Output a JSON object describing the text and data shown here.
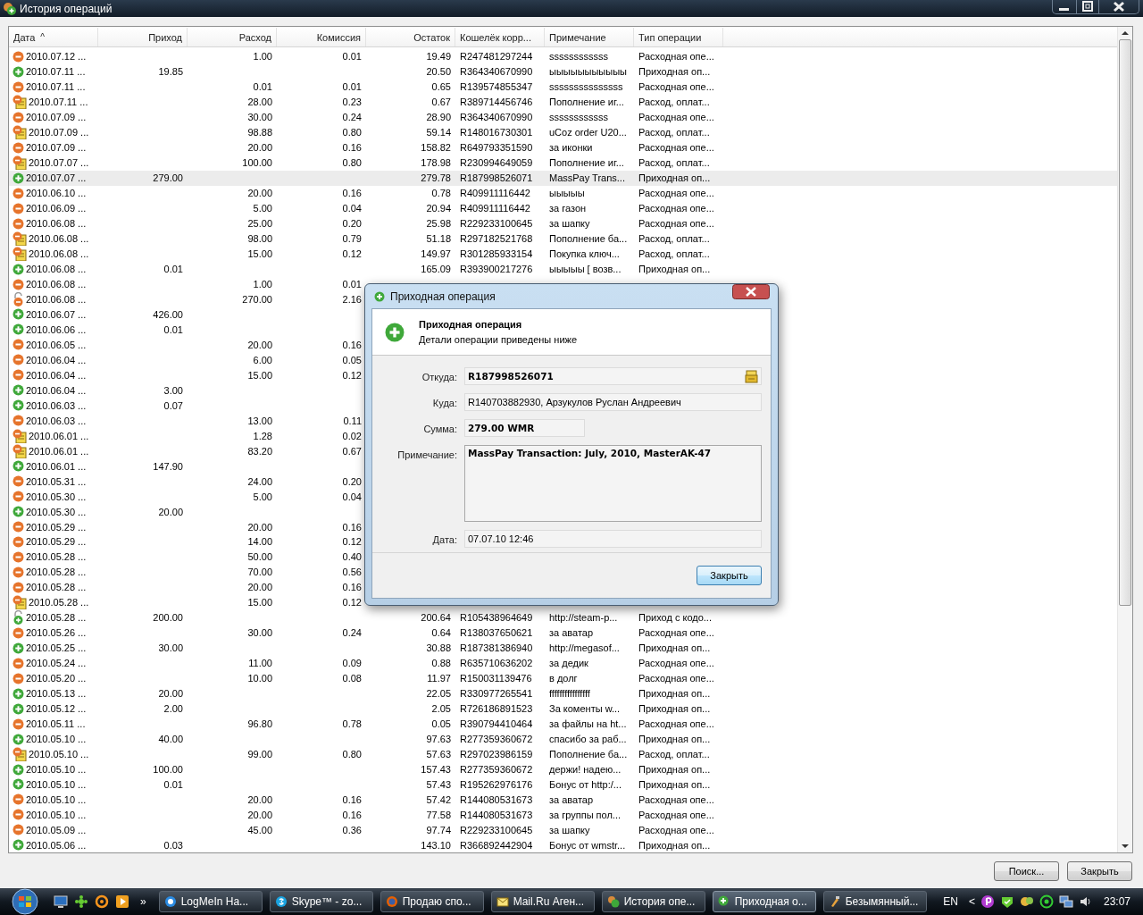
{
  "window": {
    "title": "История операций"
  },
  "table": {
    "columns": [
      {
        "label": "Дата",
        "sort_mark": "^"
      },
      {
        "label": "Приход"
      },
      {
        "label": "Расход"
      },
      {
        "label": "Комиссия"
      },
      {
        "label": "Остаток"
      },
      {
        "label": "Кошелёк корр..."
      },
      {
        "label": "Примечание"
      },
      {
        "label": "Тип операции"
      }
    ],
    "rows": [
      {
        "kind": "expense",
        "selected": false,
        "date": "2010.07.12 ...",
        "expense": "1.00",
        "fee": "0.01",
        "balance": "19.49",
        "wallet": "R247481297244",
        "note": "ssssssssssss",
        "type": "Расходная опе..."
      },
      {
        "kind": "income",
        "selected": false,
        "date": "2010.07.11 ...",
        "income": "19.85",
        "balance": "20.50",
        "wallet": "R364340670990",
        "note": "ыыыыыыыыыыы",
        "type": "Приходная оп..."
      },
      {
        "kind": "expense",
        "selected": false,
        "date": "2010.07.11 ...",
        "expense": "0.01",
        "fee": "0.01",
        "balance": "0.65",
        "wallet": "R139574855347",
        "note": "sssssssssssssss",
        "type": "Расходная опе..."
      },
      {
        "kind": "invoice",
        "selected": false,
        "date": "2010.07.11 ...",
        "expense": "28.00",
        "fee": "0.23",
        "balance": "0.67",
        "wallet": "R389714456746",
        "note": "Пополнение иг...",
        "type": "Расход, оплат..."
      },
      {
        "kind": "expense",
        "selected": false,
        "date": "2010.07.09 ...",
        "expense": "30.00",
        "fee": "0.24",
        "balance": "28.90",
        "wallet": "R364340670990",
        "note": "ssssssssssss",
        "type": "Расходная опе..."
      },
      {
        "kind": "invoice",
        "selected": false,
        "date": "2010.07.09 ...",
        "expense": "98.88",
        "fee": "0.80",
        "balance": "59.14",
        "wallet": "R148016730301",
        "note": "uCoz order U20...",
        "type": "Расход, оплат..."
      },
      {
        "kind": "expense",
        "selected": false,
        "date": "2010.07.09 ...",
        "expense": "20.00",
        "fee": "0.16",
        "balance": "158.82",
        "wallet": "R649793351590",
        "note": "за иконки",
        "type": "Расходная опе..."
      },
      {
        "kind": "invoice",
        "selected": false,
        "date": "2010.07.07 ...",
        "expense": "100.00",
        "fee": "0.80",
        "balance": "178.98",
        "wallet": "R230994649059",
        "note": "Пополнение иг...",
        "type": "Расход, оплат..."
      },
      {
        "kind": "income",
        "selected": true,
        "date": "2010.07.07 ...",
        "income": "279.00",
        "balance": "279.78",
        "wallet": "R187998526071",
        "note": "MassPay Trans...",
        "type": "Приходная оп..."
      },
      {
        "kind": "expense",
        "selected": false,
        "date": "2010.06.10 ...",
        "expense": "20.00",
        "fee": "0.16",
        "balance": "0.78",
        "wallet": "R409911116442",
        "note": "ыыыыы",
        "type": "Расходная опе..."
      },
      {
        "kind": "expense",
        "selected": false,
        "date": "2010.06.09 ...",
        "expense": "5.00",
        "fee": "0.04",
        "balance": "20.94",
        "wallet": "R409911116442",
        "note": "за газон",
        "type": "Расходная опе..."
      },
      {
        "kind": "expense",
        "selected": false,
        "date": "2010.06.08 ...",
        "expense": "25.00",
        "fee": "0.20",
        "balance": "25.98",
        "wallet": "R229233100645",
        "note": "за шапку",
        "type": "Расходная опе..."
      },
      {
        "kind": "invoice",
        "selected": false,
        "date": "2010.06.08 ...",
        "expense": "98.00",
        "fee": "0.79",
        "balance": "51.18",
        "wallet": "R297182521768",
        "note": "Пополнение ба...",
        "type": "Расход, оплат..."
      },
      {
        "kind": "invoice",
        "selected": false,
        "date": "2010.06.08 ...",
        "expense": "15.00",
        "fee": "0.12",
        "balance": "149.97",
        "wallet": "R301285933154",
        "note": "Покупка ключ...",
        "type": "Расход, оплат..."
      },
      {
        "kind": "income",
        "selected": false,
        "date": "2010.06.08 ...",
        "income": "0.01",
        "balance": "165.09",
        "wallet": "R393900217276",
        "note": "ыыыыы [ возв...",
        "type": "Приходная оп..."
      },
      {
        "kind": "expense",
        "selected": false,
        "date": "2010.06.08 ...",
        "expense": "1.00",
        "fee": "0.01"
      },
      {
        "kind": "coded_out",
        "selected": false,
        "date": "2010.06.08 ...",
        "expense": "270.00",
        "fee": "2.16"
      },
      {
        "kind": "income",
        "selected": false,
        "date": "2010.06.07 ...",
        "income": "426.00"
      },
      {
        "kind": "income",
        "selected": false,
        "date": "2010.06.06 ...",
        "income": "0.01"
      },
      {
        "kind": "expense",
        "selected": false,
        "date": "2010.06.05 ...",
        "expense": "20.00",
        "fee": "0.16"
      },
      {
        "kind": "expense",
        "selected": false,
        "date": "2010.06.04 ...",
        "expense": "6.00",
        "fee": "0.05"
      },
      {
        "kind": "expense",
        "selected": false,
        "date": "2010.06.04 ...",
        "expense": "15.00",
        "fee": "0.12"
      },
      {
        "kind": "income",
        "selected": false,
        "date": "2010.06.04 ...",
        "income": "3.00"
      },
      {
        "kind": "income",
        "selected": false,
        "date": "2010.06.03 ...",
        "income": "0.07"
      },
      {
        "kind": "expense",
        "selected": false,
        "date": "2010.06.03 ...",
        "expense": "13.00",
        "fee": "0.11"
      },
      {
        "kind": "invoice",
        "selected": false,
        "date": "2010.06.01 ...",
        "expense": "1.28",
        "fee": "0.02"
      },
      {
        "kind": "invoice",
        "selected": false,
        "date": "2010.06.01 ...",
        "expense": "83.20",
        "fee": "0.67"
      },
      {
        "kind": "income",
        "selected": false,
        "date": "2010.06.01 ...",
        "income": "147.90"
      },
      {
        "kind": "expense",
        "selected": false,
        "date": "2010.05.31 ...",
        "expense": "24.00",
        "fee": "0.20"
      },
      {
        "kind": "expense",
        "selected": false,
        "date": "2010.05.30 ...",
        "expense": "5.00",
        "fee": "0.04"
      },
      {
        "kind": "income",
        "selected": false,
        "date": "2010.05.30 ...",
        "income": "20.00"
      },
      {
        "kind": "expense",
        "selected": false,
        "date": "2010.05.29 ...",
        "expense": "20.00",
        "fee": "0.16"
      },
      {
        "kind": "expense",
        "selected": false,
        "date": "2010.05.29 ...",
        "expense": "14.00",
        "fee": "0.12"
      },
      {
        "kind": "expense",
        "selected": false,
        "date": "2010.05.28 ...",
        "expense": "50.00",
        "fee": "0.40"
      },
      {
        "kind": "expense",
        "selected": false,
        "date": "2010.05.28 ...",
        "expense": "70.00",
        "fee": "0.56"
      },
      {
        "kind": "expense",
        "selected": false,
        "date": "2010.05.28 ...",
        "expense": "20.00",
        "fee": "0.16"
      },
      {
        "kind": "invoice",
        "selected": false,
        "date": "2010.05.28 ...",
        "expense": "15.00",
        "fee": "0.12"
      },
      {
        "kind": "coded_in",
        "selected": false,
        "date": "2010.05.28 ...",
        "income": "200.00",
        "balance": "200.64",
        "wallet": "R105438964649",
        "note": "http://steam-p...",
        "type": "Приход с кодо..."
      },
      {
        "kind": "expense",
        "selected": false,
        "date": "2010.05.26 ...",
        "expense": "30.00",
        "fee": "0.24",
        "balance": "0.64",
        "wallet": "R138037650621",
        "note": "за аватар",
        "type": "Расходная опе..."
      },
      {
        "kind": "income",
        "selected": false,
        "date": "2010.05.25 ...",
        "income": "30.00",
        "balance": "30.88",
        "wallet": "R187381386940",
        "note": "http://megasof...",
        "type": "Приходная оп..."
      },
      {
        "kind": "expense",
        "selected": false,
        "date": "2010.05.24 ...",
        "expense": "11.00",
        "fee": "0.09",
        "balance": "0.88",
        "wallet": "R635710636202",
        "note": "за дедик",
        "type": "Расходная опе..."
      },
      {
        "kind": "expense",
        "selected": false,
        "date": "2010.05.20 ...",
        "expense": "10.00",
        "fee": "0.08",
        "balance": "11.97",
        "wallet": "R150031139476",
        "note": "в долг",
        "type": "Расходная опе..."
      },
      {
        "kind": "income",
        "selected": false,
        "date": "2010.05.13 ...",
        "income": "20.00",
        "balance": "22.05",
        "wallet": "R330977265541",
        "note": "ffffffffffffffff",
        "type": "Приходная оп..."
      },
      {
        "kind": "income",
        "selected": false,
        "date": "2010.05.12 ...",
        "income": "2.00",
        "balance": "2.05",
        "wallet": "R726186891523",
        "note": "За коменты w...",
        "type": "Приходная оп..."
      },
      {
        "kind": "expense",
        "selected": false,
        "date": "2010.05.11 ...",
        "expense": "96.80",
        "fee": "0.78",
        "balance": "0.05",
        "wallet": "R390794410464",
        "note": "за файлы на ht...",
        "type": "Расходная опе..."
      },
      {
        "kind": "income",
        "selected": false,
        "date": "2010.05.10 ...",
        "income": "40.00",
        "balance": "97.63",
        "wallet": "R277359360672",
        "note": "спасибо за раб...",
        "type": "Приходная оп..."
      },
      {
        "kind": "invoice",
        "selected": false,
        "date": "2010.05.10 ...",
        "expense": "99.00",
        "fee": "0.80",
        "balance": "57.63",
        "wallet": "R297023986159",
        "note": "Пополнение ба...",
        "type": "Расход, оплат..."
      },
      {
        "kind": "income",
        "selected": false,
        "date": "2010.05.10 ...",
        "income": "100.00",
        "balance": "157.43",
        "wallet": "R277359360672",
        "note": "держи! надею...",
        "type": "Приходная оп..."
      },
      {
        "kind": "income",
        "selected": false,
        "date": "2010.05.10 ...",
        "income": "0.01",
        "balance": "57.43",
        "wallet": "R195262976176",
        "note": "Бонус от http:/...",
        "type": "Приходная оп..."
      },
      {
        "kind": "expense",
        "selected": false,
        "date": "2010.05.10 ...",
        "expense": "20.00",
        "fee": "0.16",
        "balance": "57.42",
        "wallet": "R144080531673",
        "note": "за аватар",
        "type": "Расходная опе..."
      },
      {
        "kind": "expense",
        "selected": false,
        "date": "2010.05.10 ...",
        "expense": "20.00",
        "fee": "0.16",
        "balance": "77.58",
        "wallet": "R144080531673",
        "note": "за группы пол...",
        "type": "Расходная опе..."
      },
      {
        "kind": "expense",
        "selected": false,
        "date": "2010.05.09 ...",
        "expense": "45.00",
        "fee": "0.36",
        "balance": "97.74",
        "wallet": "R229233100645",
        "note": "за шапку",
        "type": "Расходная опе..."
      },
      {
        "kind": "income",
        "selected": false,
        "date": "2010.05.06 ...",
        "income": "0.03",
        "balance": "143.10",
        "wallet": "R366892442904",
        "note": "Бонус от wmstr...",
        "type": "Приходная оп..."
      }
    ]
  },
  "buttons": [
    "Поиск...",
    "Закрыть"
  ],
  "dialog": {
    "title": "Приходная операция",
    "heading": "Приходная операция",
    "subtitle": "Детали операции приведены ниже",
    "fields": [
      {
        "kind": "wallet",
        "label": "Откуда:",
        "value": "R187998526071",
        "bold": true
      },
      {
        "kind": "line",
        "label": "Куда:",
        "value": "R140703882930, Арзукулов Руслан Андреевич",
        "bold": false
      },
      {
        "kind": "amount",
        "label": "Сумма:",
        "value": "279.00 WMR",
        "bold": true
      },
      {
        "kind": "memo",
        "label": "Примечание:",
        "value": "MassPay Transaction: July, 2010, MasterAK-47",
        "bold": true
      },
      {
        "kind": "line",
        "label": "Дата:",
        "value": "07.07.10 12:46",
        "bold": false
      }
    ],
    "button": "Закрыть"
  },
  "taskbar": {
    "quick_launch_more": "»",
    "tasks": [
      {
        "label": "LogMeIn На...",
        "selected": false
      },
      {
        "label": "Skype™ - zo...",
        "selected": false
      },
      {
        "label": "Продаю спо...",
        "selected": false
      },
      {
        "label": "Mail.Ru Аген...",
        "selected": false
      },
      {
        "label": "История опе...",
        "selected": false
      },
      {
        "label": "Приходная о...",
        "selected": true
      },
      {
        "label": "Безымянный...",
        "selected": false
      }
    ],
    "language": "EN",
    "tray_expand": "<",
    "clock": "23:07"
  }
}
